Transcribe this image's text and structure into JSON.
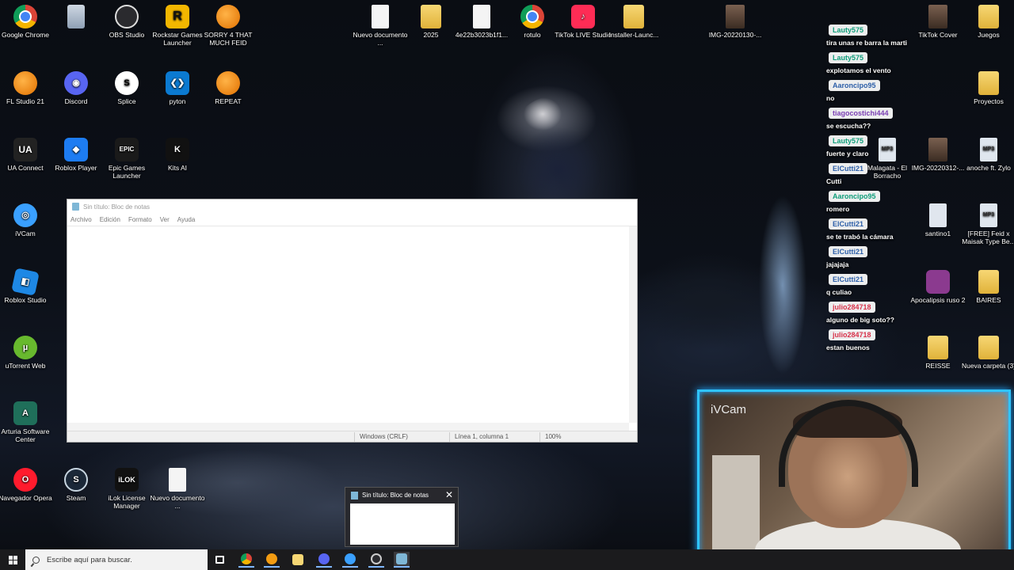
{
  "desktop": {
    "icons": [
      {
        "label": "Google Chrome",
        "icon": "chrome-icon",
        "glyph": ""
      },
      {
        "label": "",
        "icon": "recycle-bin-icon",
        "glyph": ""
      },
      {
        "label": "OBS Studio",
        "icon": "obs-icon",
        "glyph": ""
      },
      {
        "label": "Rockstar Games Launcher",
        "icon": "rockstar-icon",
        "glyph": "R"
      },
      {
        "label": "SORRY 4 THAT MUCH FEID",
        "icon": "fl-studio-icon",
        "glyph": ""
      },
      {
        "label": "Nuevo documento ...",
        "icon": "document-icon",
        "glyph": ""
      },
      {
        "label": "2025",
        "icon": "folder-icon",
        "glyph": ""
      },
      {
        "label": "4e22b3023b1f1...",
        "icon": "document-icon",
        "glyph": ""
      },
      {
        "label": "rotulo",
        "icon": "chrome-file-icon",
        "glyph": ""
      },
      {
        "label": "TikTok LIVE Studio",
        "icon": "tiktok-icon",
        "glyph": "♪"
      },
      {
        "label": "Installer-Launc...",
        "icon": "folder-icon",
        "glyph": ""
      },
      {
        "label": "IMG-20220130-...",
        "icon": "image-icon",
        "glyph": ""
      },
      {
        "label": "FL Studio 21",
        "icon": "fl-studio-icon",
        "glyph": ""
      },
      {
        "label": "Discord",
        "icon": "discord-icon",
        "glyph": "◉"
      },
      {
        "label": "Splice",
        "icon": "splice-icon",
        "glyph": "S"
      },
      {
        "label": "pyton",
        "icon": "vscode-icon",
        "glyph": "❮❯"
      },
      {
        "label": "REPEAT",
        "icon": "fl-studio-icon",
        "glyph": ""
      },
      {
        "label": "UA Connect",
        "icon": "ua-connect-icon",
        "glyph": "UA"
      },
      {
        "label": "Roblox Player",
        "icon": "roblox-icon",
        "glyph": "◆"
      },
      {
        "label": "Epic Games Launcher",
        "icon": "epic-games-icon",
        "glyph": "EPIC"
      },
      {
        "label": "Kits AI",
        "icon": "kits-ai-icon",
        "glyph": "K"
      },
      {
        "label": "iVCam",
        "icon": "ivcam-icon",
        "glyph": "◎"
      },
      {
        "label": "Roblox Studio",
        "icon": "roblox-studio-icon",
        "glyph": "◧"
      },
      {
        "label": "uTorrent Web",
        "icon": "utorrent-icon",
        "glyph": "µ"
      },
      {
        "label": "Arturia Software Center",
        "icon": "arturia-icon",
        "glyph": "A"
      },
      {
        "label": "Navegador Opera",
        "icon": "opera-icon",
        "glyph": "O"
      },
      {
        "label": "Steam",
        "icon": "steam-icon",
        "glyph": "S"
      },
      {
        "label": "iLok License Manager",
        "icon": "ilok-icon",
        "glyph": "iLOK"
      },
      {
        "label": "Nuevo documento ...",
        "icon": "document-icon",
        "glyph": ""
      },
      {
        "label": "TikTok Cover",
        "icon": "image-icon",
        "glyph": ""
      },
      {
        "label": "Juegos",
        "icon": "folder-icon",
        "glyph": ""
      },
      {
        "label": "Proyectos",
        "icon": "folder-icon",
        "glyph": ""
      },
      {
        "label": "Malagata - El Borracho",
        "icon": "mp3-icon",
        "glyph": "MP3"
      },
      {
        "label": "IMG-20220312-...",
        "icon": "image-icon",
        "glyph": ""
      },
      {
        "label": "anoche ft. Zylo",
        "icon": "mp3-icon",
        "glyph": "MP3"
      },
      {
        "label": "santino1",
        "icon": "python-file-icon",
        "glyph": ""
      },
      {
        "label": "[FREE] Feid x Maisak Type Be...",
        "icon": "mp3-icon",
        "glyph": "MP3"
      },
      {
        "label": "Apocalipsis ruso 2",
        "icon": "winrar-icon",
        "glyph": ""
      },
      {
        "label": "BAIRES",
        "icon": "folder-icon",
        "glyph": ""
      },
      {
        "label": "REISSE",
        "icon": "folder-icon",
        "glyph": ""
      },
      {
        "label": "Nueva carpeta (3)",
        "icon": "folder-icon",
        "glyph": ""
      }
    ]
  },
  "notepad": {
    "title": "Sin título: Bloc de notas",
    "menu": [
      "Archivo",
      "Edición",
      "Formato",
      "Ver",
      "Ayuda"
    ],
    "content": "",
    "status": {
      "encoding": "Windows (CRLF)",
      "position": "Línea 1, columna 1",
      "zoom": "100%"
    }
  },
  "chat": {
    "messages": [
      {
        "user": "Lauty575",
        "text": "tira unas re barra la marti",
        "color": "#0f9d7a"
      },
      {
        "user": "Lauty575",
        "text": "explotamos el vento",
        "color": "#0f9d7a"
      },
      {
        "user": "Aaroncipo95",
        "text": "no",
        "color": "#2d5fa8"
      },
      {
        "user": "tiagocostichi444",
        "text": "se escucha??",
        "color": "#7b3fb3"
      },
      {
        "user": "Lauty575",
        "text": "fuerte y claro",
        "color": "#0f9d7a"
      },
      {
        "user": "ElCutti21",
        "text": "Cutti",
        "color": "#2d5fa8"
      },
      {
        "user": "Aaroncipo95",
        "text": "romero",
        "color": "#0f9d7a"
      },
      {
        "user": "ElCutti21",
        "text": "se te trabó la cámara",
        "color": "#2d5fa8"
      },
      {
        "user": "ElCutti21",
        "text": "jajajaja",
        "color": "#2d5fa8"
      },
      {
        "user": "ElCutti21",
        "text": "q culiao",
        "color": "#2d5fa8"
      },
      {
        "user": "julio284718",
        "text": "alguno de big soto??",
        "color": "#d8324a"
      },
      {
        "user": "julio284718",
        "text": "estan buenos",
        "color": "#d8324a"
      }
    ]
  },
  "webcam": {
    "label": "iVCam"
  },
  "taskbar_preview": {
    "title": "Sin título: Bloc de notas",
    "close": "✕"
  },
  "taskbar": {
    "search_placeholder": "Escribe aquí para buscar.",
    "apps": [
      {
        "name": "task-view",
        "color": "#ffffff"
      },
      {
        "name": "chrome",
        "color": "#db4437"
      },
      {
        "name": "fl-studio",
        "color": "#f39c12"
      },
      {
        "name": "file-explorer",
        "color": "#f7d774"
      },
      {
        "name": "discord",
        "color": "#5865f2"
      },
      {
        "name": "ivcam",
        "color": "#3aa0ff"
      },
      {
        "name": "obs",
        "color": "#cccccc"
      },
      {
        "name": "notepad",
        "color": "#7fb7d6"
      }
    ]
  }
}
